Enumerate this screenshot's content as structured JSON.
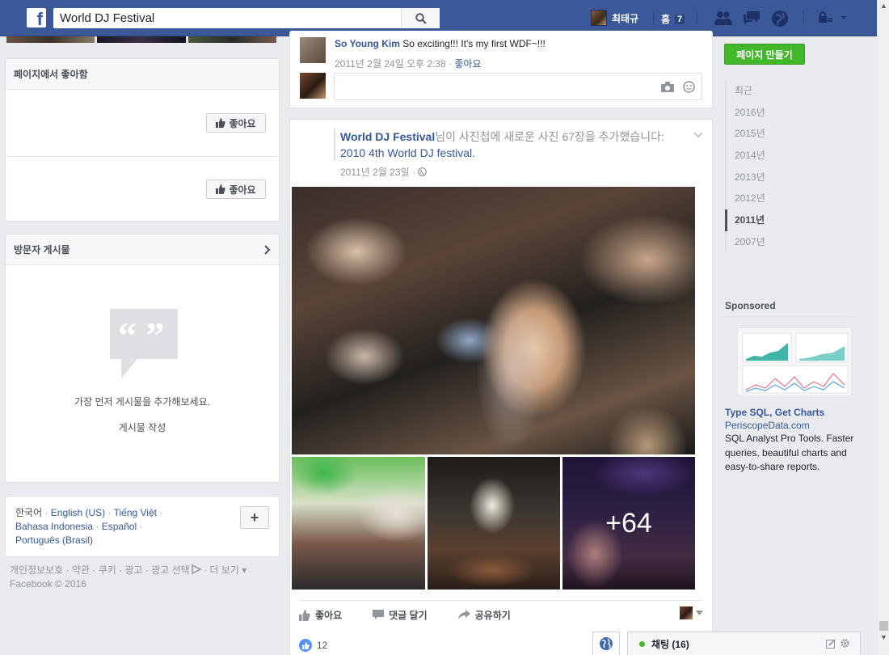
{
  "topbar": {
    "search_value": "World DJ Festival",
    "user_name": "최태규",
    "home_label": "홈",
    "home_count": "7",
    "icons": [
      "friend-requests-icon",
      "messages-icon",
      "notifications-icon",
      "privacy-lock-icon",
      "account-menu-icon"
    ],
    "brand_color": "#3b5998"
  },
  "left": {
    "liked_pages_header": "페이지에서 좋아함",
    "like_button_label": "좋아요",
    "visitor_posts_header": "방문자 게시물",
    "visitor_posts_empty": "가장 먼저 게시물을 추가해보세요.",
    "write_post_label": "게시물 작성",
    "languages": [
      "한국어",
      "English (US)",
      "Tiếng Việt",
      "Bahasa Indonesia",
      "Español",
      "Português (Brasil)"
    ],
    "footer_links": [
      "개인정보보호",
      "약관",
      "쿠키",
      "광고",
      "광고 선택",
      "더 보기"
    ],
    "copyright": "Facebook © 2016"
  },
  "feed": {
    "comment": {
      "author": "So Young Kim",
      "text": "So exciting!!! It's my first WDF~!!!",
      "time": "2011년 2월 24일 오후 2:38",
      "like_label": "좋아요"
    },
    "post": {
      "page_name": "World DJ Festival",
      "action_text": "님이 사진첩에 새로운 사진 67장을 추가했습니다: ",
      "album_name": "2010 4th World DJ festival.",
      "date": "2011년 2월 23일",
      "more_photos": "+64",
      "actions": {
        "like": "좋아요",
        "comment": "댓글 달기",
        "share": "공유하기"
      },
      "like_count": "12"
    }
  },
  "right": {
    "create_page_label": "페이지 만들기",
    "years": [
      "최근",
      "2016년",
      "2015년",
      "2014년",
      "2013년",
      "2012년",
      "2011년",
      "2007년"
    ],
    "active_year": "2011년",
    "sponsored_label": "Sponsored",
    "ad": {
      "title": "Type SQL, Get Charts",
      "domain": "PeriscopeData.com",
      "body": "SQL Analyst Pro Tools. Faster queries, beautiful charts and easy-to-share reports."
    },
    "accent_green": "#42b72a"
  },
  "chat": {
    "label": "채팅 (16)"
  }
}
